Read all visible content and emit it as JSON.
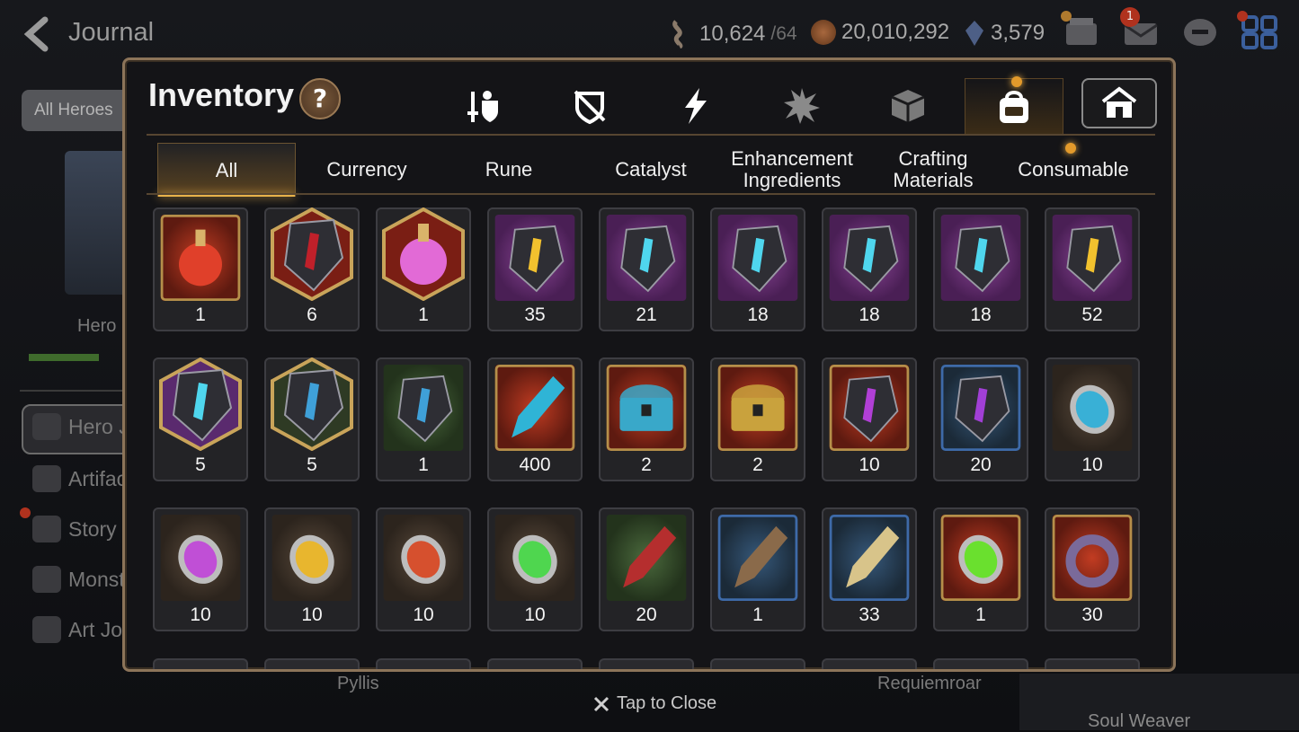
{
  "header": {
    "title": "Journal",
    "stamina": {
      "value": "10,624",
      "max": "/64"
    },
    "gold": "20,010,292",
    "crystals": "3,579",
    "mail_badge": "1"
  },
  "left_panel": {
    "filter_label": "All Heroes",
    "hero_label": "Hero",
    "nav_items": [
      {
        "label": "Hero Journal"
      },
      {
        "label": "Artifacts"
      },
      {
        "label": "Story"
      },
      {
        "label": "Monsters"
      },
      {
        "label": "Art Journal"
      }
    ]
  },
  "bottom": {
    "name_left": "Pyllis",
    "name_right": "Requiemroar",
    "name_far_right": "Soul Weaver",
    "tap_close": "Tap to Close"
  },
  "modal": {
    "title": "Inventory",
    "help_label": "?",
    "category_tabs": [
      {
        "icon": "equipment-icon",
        "active": false
      },
      {
        "icon": "no-equip-icon",
        "active": false
      },
      {
        "icon": "artifact-lightning-icon",
        "active": false
      },
      {
        "icon": "burst-icon",
        "active": false
      },
      {
        "icon": "material-cube-icon",
        "active": false
      },
      {
        "icon": "bag-icon",
        "active": true
      },
      {
        "icon": "storage-house-icon",
        "active": false,
        "boxed": true
      }
    ],
    "sub_tabs": [
      {
        "label": "All",
        "active": true
      },
      {
        "label": "Currency",
        "active": false
      },
      {
        "label": "Rune",
        "active": false
      },
      {
        "label": "Catalyst",
        "active": false
      },
      {
        "label": "Enhancement\nIngredients",
        "active": false
      },
      {
        "label": "Crafting\nMaterials",
        "active": false
      },
      {
        "label": "Consumable",
        "active": false
      }
    ],
    "items": [
      {
        "count": "1",
        "name": "red-potion-icon",
        "bg": "red",
        "hex": false
      },
      {
        "count": "6",
        "name": "red-gem-icon",
        "bg": "red",
        "hex": true
      },
      {
        "count": "1",
        "name": "pink-potion-icon",
        "bg": "red",
        "hex": true
      },
      {
        "count": "35",
        "name": "rune-stone-exclaim-icon",
        "bg": "purple",
        "hex": false
      },
      {
        "count": "21",
        "name": "rune-stone-bell-icon",
        "bg": "purple",
        "hex": false
      },
      {
        "count": "18",
        "name": "rune-stone-boot-icon",
        "bg": "purple",
        "hex": false
      },
      {
        "count": "18",
        "name": "rune-stone-sword-icon",
        "bg": "purple",
        "hex": false
      },
      {
        "count": "18",
        "name": "rune-stone-spiral-icon",
        "bg": "purple",
        "hex": false
      },
      {
        "count": "52",
        "name": "rune-stone-hammer-icon",
        "bg": "purple",
        "hex": false
      },
      {
        "count": "5",
        "name": "purple-star-stone-icon",
        "bg": "purple",
        "hex": true
      },
      {
        "count": "5",
        "name": "white-star-stone-icon",
        "bg": "green",
        "hex": true
      },
      {
        "count": "1",
        "name": "white-rune-stone-icon",
        "bg": "green",
        "hex": false
      },
      {
        "count": "400",
        "name": "blue-crystal-shard-icon",
        "bg": "red",
        "hex": false
      },
      {
        "count": "2",
        "name": "blue-chest-icon",
        "bg": "red",
        "hex": false
      },
      {
        "count": "2",
        "name": "gold-chest-icon",
        "bg": "red",
        "hex": false
      },
      {
        "count": "10",
        "name": "purple-moon-gem-icon",
        "bg": "red",
        "hex": false
      },
      {
        "count": "20",
        "name": "purple-triangle-gem-icon",
        "bg": "blue",
        "hex": false
      },
      {
        "count": "10",
        "name": "blue-rune-oval-icon",
        "bg": "brown",
        "hex": false
      },
      {
        "count": "10",
        "name": "purple-moon-oval-icon",
        "bg": "brown",
        "hex": false
      },
      {
        "count": "10",
        "name": "yellow-oval-icon",
        "bg": "brown",
        "hex": false
      },
      {
        "count": "10",
        "name": "red-oval-icon",
        "bg": "brown",
        "hex": false
      },
      {
        "count": "10",
        "name": "green-oval-icon",
        "bg": "brown",
        "hex": false
      },
      {
        "count": "20",
        "name": "horn-claw-icon",
        "bg": "green",
        "hex": false
      },
      {
        "count": "1",
        "name": "wooden-tool-icon",
        "bg": "blue",
        "hex": false
      },
      {
        "count": "33",
        "name": "herb-root-icon",
        "bg": "blue",
        "hex": false
      },
      {
        "count": "1",
        "name": "green-orb-icon",
        "bg": "red",
        "hex": false
      },
      {
        "count": "30",
        "name": "coil-pendant-icon",
        "bg": "red",
        "hex": false
      }
    ]
  },
  "colors": {
    "accent_gold": "#e8b24a",
    "frame_brown": "#8c7459",
    "notification_red": "#b0321e"
  }
}
